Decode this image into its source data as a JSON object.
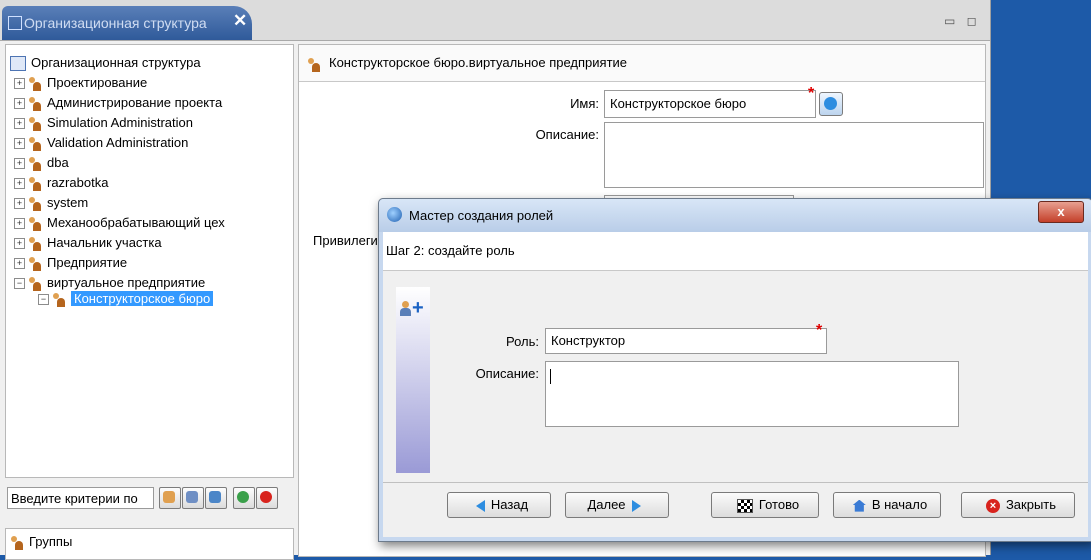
{
  "tab": {
    "title": "Организационная структура",
    "close": "✕"
  },
  "window_controls": "▭ ◻",
  "tree": {
    "root": "Организационная структура",
    "items": [
      {
        "label": "Проектирование",
        "exp": "+"
      },
      {
        "label": "Администрирование проекта",
        "exp": "+"
      },
      {
        "label": "Simulation Administration",
        "exp": "+"
      },
      {
        "label": "Validation Administration",
        "exp": "+"
      },
      {
        "label": "dba",
        "exp": "+"
      },
      {
        "label": "razrabotka",
        "exp": "+"
      },
      {
        "label": "system",
        "exp": "+"
      },
      {
        "label": "Механообрабатывающий цех",
        "exp": "+"
      },
      {
        "label": "Начальник участка",
        "exp": "+"
      },
      {
        "label": "Предприятие",
        "exp": "+"
      },
      {
        "label": "виртуальное предприятие",
        "exp": "−"
      }
    ],
    "selected_child": {
      "label": "Конструкторское бюро",
      "exp": "−"
    }
  },
  "search": {
    "placeholder": "Введите критерии по"
  },
  "bottom_list": {
    "item": "Группы"
  },
  "detail": {
    "title": "Конструкторское бюро.виртуальное предприятие",
    "name_label": "Имя:",
    "name_value": "Конструкторское бюро",
    "desc_label": "Описание:",
    "priv_label": "Привилеги"
  },
  "dialog": {
    "title": "Мастер создания ролей",
    "close": "x",
    "step": "Шаг 2: создайте роль",
    "role_label": "Роль:",
    "role_value": "Конструктор",
    "desc_label": "Описание:",
    "buttons": {
      "back": "Назад",
      "next": "Далее",
      "finish": "Готово",
      "start": "В начало",
      "close": "Закрыть"
    }
  },
  "colors": {
    "selection": "#3399ff",
    "required": "#e00000",
    "dialog_frame": "#c7d8ef"
  }
}
